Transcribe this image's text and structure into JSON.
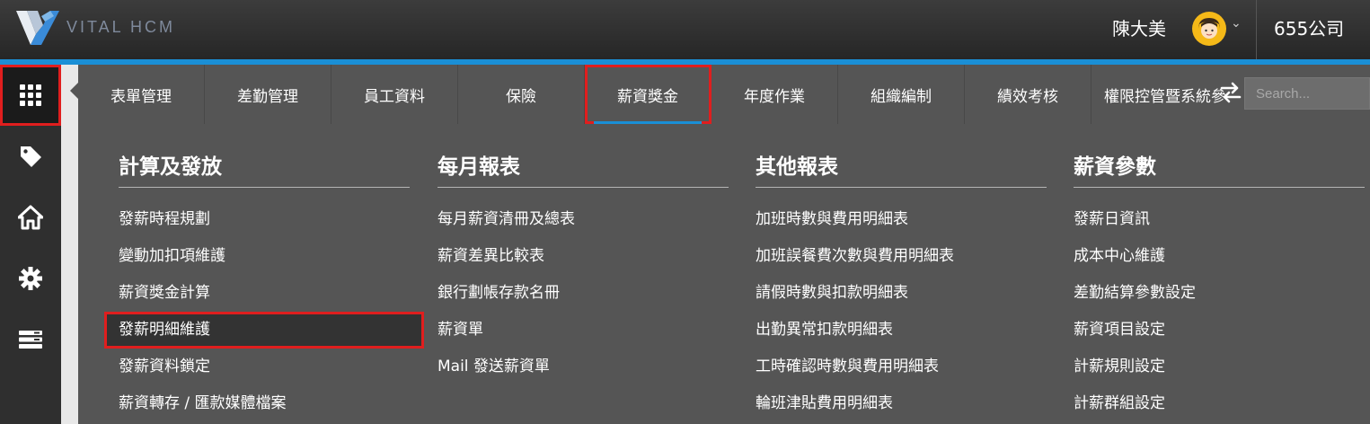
{
  "header": {
    "brand": "VITAL HCM",
    "user_name": "陳大美",
    "company": "655公司"
  },
  "sidebar": {
    "items": [
      {
        "icon": "apps-grid-icon",
        "active": true
      },
      {
        "icon": "tag-icon"
      },
      {
        "icon": "home-icon"
      },
      {
        "icon": "gear-icon"
      },
      {
        "icon": "server-icon"
      }
    ]
  },
  "tabs": [
    {
      "label": "表單管理"
    },
    {
      "label": "差勤管理"
    },
    {
      "label": "員工資料"
    },
    {
      "label": "保險"
    },
    {
      "label": "薪資獎金",
      "active": true
    },
    {
      "label": "年度作業"
    },
    {
      "label": "組織編制"
    },
    {
      "label": "績效考核"
    },
    {
      "label": "權限控管暨系統參"
    }
  ],
  "search": {
    "placeholder": "Search..."
  },
  "columns": [
    {
      "title": "計算及發放",
      "items": [
        "發薪時程規劃",
        "變動加扣項維護",
        "薪資獎金計算",
        "發薪明細維護",
        "發薪資料鎖定",
        "薪資轉存 / 匯款媒體檔案"
      ],
      "highlighted_index": 3
    },
    {
      "title": "每月報表",
      "items": [
        "每月薪資清冊及總表",
        "薪資差異比較表",
        "銀行劃帳存款名冊",
        "薪資單",
        "Mail 發送薪資單"
      ]
    },
    {
      "title": "其他報表",
      "items": [
        "加班時數與費用明細表",
        "加班誤餐費次數與費用明細表",
        "請假時數與扣款明細表",
        "出勤異常扣款明細表",
        "工時確認時數與費用明細表",
        "輪班津貼費用明細表"
      ]
    },
    {
      "title": "薪資參數",
      "items": [
        "發薪日資訊",
        "成本中心維護",
        "差勤結算參數設定",
        "薪資項目設定",
        "計薪規則設定",
        "計薪群組設定"
      ]
    }
  ],
  "colors": {
    "accent": "#1a8fd6",
    "highlight_border": "#e01e1e",
    "menu_bg": "#555555",
    "topbar_bg": "#2e2e2e"
  }
}
